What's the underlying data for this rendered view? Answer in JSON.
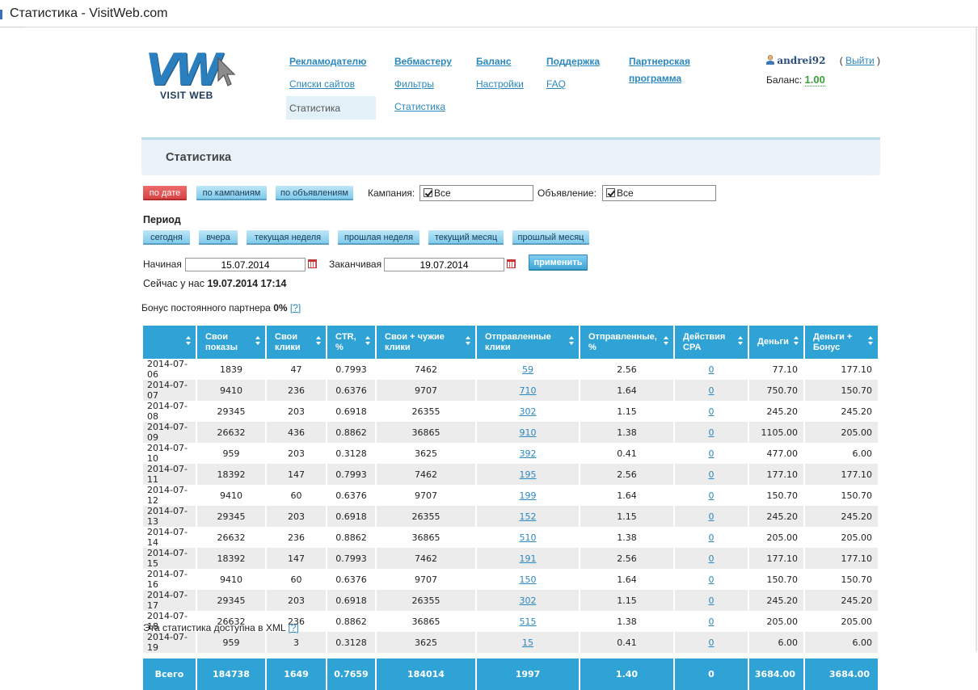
{
  "window": {
    "title": "Статистика - VisitWeb.com"
  },
  "logo": {
    "mark": "VW",
    "brand": "VISIT WEB"
  },
  "nav": {
    "advertiser": {
      "label": "Рекламодателю",
      "items": [
        "Списки сайтов",
        "Статистика"
      ]
    },
    "webmaster": {
      "label": "Вебмастеру",
      "items": [
        "Фильтры",
        "Статистика"
      ]
    },
    "balance": {
      "label": "Баланс",
      "items": [
        "Настройки"
      ]
    },
    "support": {
      "label": "Поддержка",
      "items": [
        "FAQ"
      ]
    },
    "partner": {
      "label_line1": "Партнерская",
      "label_line2": "программа"
    }
  },
  "user": {
    "name": "andrei92",
    "logout": "Выйти",
    "balance_label": "Баланс:",
    "balance_value": "1.00"
  },
  "page": {
    "title": "Статистика"
  },
  "views": {
    "by_date": "по дате",
    "by_campaign": "по кампаниям",
    "by_ad": "по объявлениям",
    "active": "by_date"
  },
  "filters": {
    "campaign_label": "Кампания:",
    "campaign_value": "Все",
    "ad_label": "Объявление:",
    "ad_value": "Все"
  },
  "period": {
    "label": "Период",
    "buttons": [
      "сегодня",
      "вчера",
      "текущая неделя",
      "прошлая неделя",
      "текущий месяц",
      "прошлый месяц"
    ],
    "start_label": "Начиная",
    "start_value": "15.07.2014",
    "end_label": "Заканчивая",
    "end_value": "19.07.2014",
    "apply": "применить",
    "now_label": "Сейчас у нас",
    "now_value": "19.07.2014 17:14"
  },
  "bonus": {
    "label": "Бонус постоянного партнера",
    "value": "0%",
    "help": "[?]"
  },
  "table": {
    "columns": [
      {
        "l1": "",
        "l2": ""
      },
      {
        "l1": "Свои",
        "l2": "показы"
      },
      {
        "l1": "Свои",
        "l2": "клики"
      },
      {
        "l1": "CTR,",
        "l2": "%"
      },
      {
        "l1": "Свои + чужие",
        "l2": "клики"
      },
      {
        "l1": "Отправленные",
        "l2": "клики"
      },
      {
        "l1": "Отправленные,",
        "l2": "%"
      },
      {
        "l1": "Действия",
        "l2": "CPA"
      },
      {
        "l1": "Деньги",
        "l2": ""
      },
      {
        "l1": "Деньги +",
        "l2": "Бонус"
      }
    ],
    "rows": [
      [
        "2014-07-06",
        "1839",
        "47",
        "0.7993",
        "7462",
        "59",
        "2.56",
        "0",
        "77.10",
        "177.10"
      ],
      [
        "2014-07-07",
        "9410",
        "236",
        "0.6376",
        "9707",
        "710",
        "1.64",
        "0",
        "750.70",
        "150.70"
      ],
      [
        "2014-07-08",
        "29345",
        "203",
        "0.6918",
        "26355",
        "302",
        "1.15",
        "0",
        "245.20",
        "245.20"
      ],
      [
        "2014-07-09",
        "26632",
        "436",
        "0.8862",
        "36865",
        "910",
        "1.38",
        "0",
        "1105.00",
        "205.00"
      ],
      [
        "2014-07-10",
        "959",
        "203",
        "0.3128",
        "3625",
        "392",
        "0.41",
        "0",
        "477.00",
        "6.00"
      ],
      [
        "2014-07-11",
        "18392",
        "147",
        "0.7993",
        "7462",
        "195",
        "2.56",
        "0",
        "177.10",
        "177.10"
      ],
      [
        "2014-07-12",
        "9410",
        "60",
        "0.6376",
        "9707",
        "199",
        "1.64",
        "0",
        "150.70",
        "150.70"
      ],
      [
        "2014-07-13",
        "29345",
        "203",
        "0.6918",
        "26355",
        "152",
        "1.15",
        "0",
        "245.20",
        "245.20"
      ],
      [
        "2014-07-14",
        "26632",
        "236",
        "0.8862",
        "36865",
        "510",
        "1.38",
        "0",
        "205.00",
        "205.00"
      ],
      [
        "2014-07-15",
        "18392",
        "147",
        "0.7993",
        "7462",
        "191",
        "2.56",
        "0",
        "177.10",
        "177.10"
      ],
      [
        "2014-07-16",
        "9410",
        "60",
        "0.6376",
        "9707",
        "150",
        "1.64",
        "0",
        "150.70",
        "150.70"
      ],
      [
        "2014-07-17",
        "29345",
        "203",
        "0.6918",
        "26355",
        "302",
        "1.15",
        "0",
        "245.20",
        "245.20"
      ],
      [
        "2014-07-18",
        "26632",
        "236",
        "0.8862",
        "36865",
        "515",
        "1.38",
        "0",
        "205.00",
        "205.00"
      ],
      [
        "2014-07-19",
        "959",
        "3",
        "0.3128",
        "3625",
        "15",
        "0.41",
        "0",
        "6.00",
        "6.00"
      ]
    ],
    "total": [
      "Всего",
      "184738",
      "1649",
      "0.7659",
      "184014",
      "1997",
      "1.40",
      "0",
      "3684.00",
      "3684.00"
    ]
  },
  "footer": {
    "text": "Эта статистика доступна в XML",
    "help": "[?]"
  },
  "colors": {
    "accent": "#2fa3d5",
    "link": "#2b88bf",
    "active_button": "#d94545",
    "balance": "#3aa13a"
  }
}
